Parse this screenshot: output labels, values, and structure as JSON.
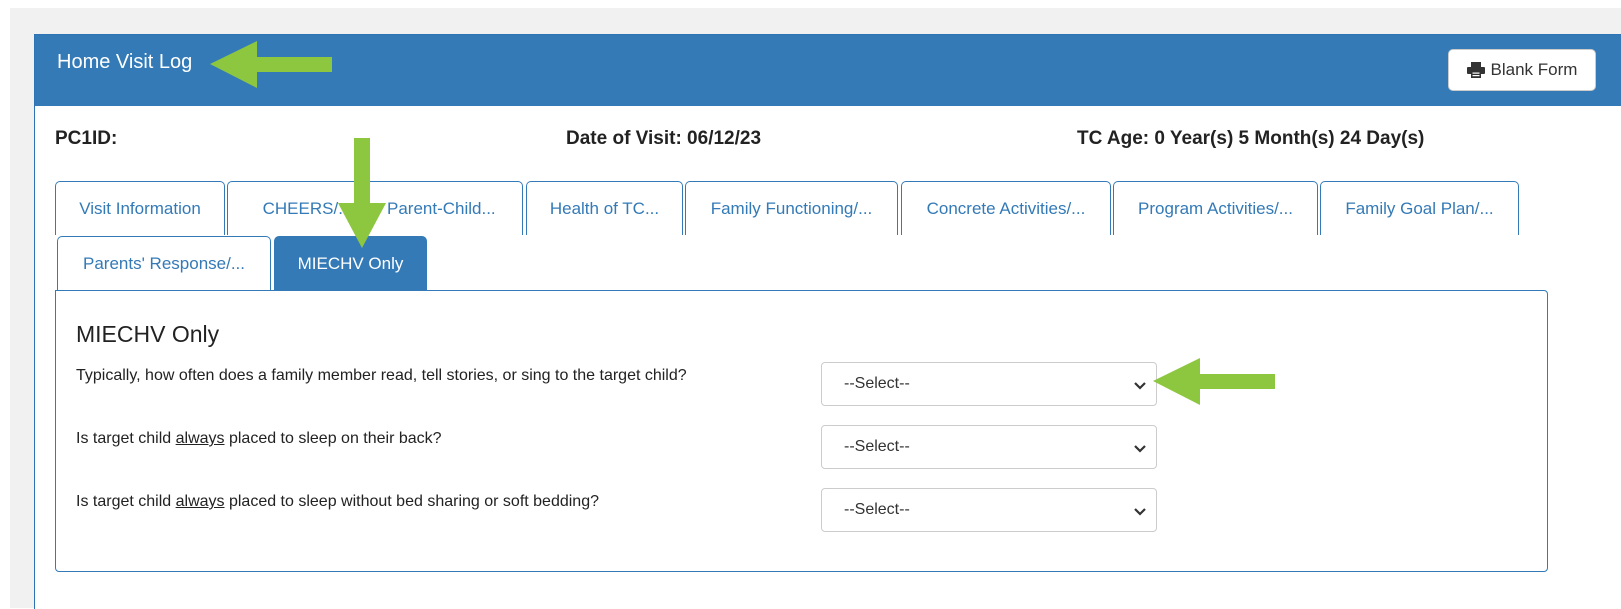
{
  "panel": {
    "title": "Home Visit Log",
    "blank_form_label": "Blank Form"
  },
  "info": {
    "pc1id": "PC1ID:",
    "date_of_visit": "Date of Visit: 06/12/23",
    "tc_age": "TC Age: 0 Year(s) 5 Month(s) 24 Day(s)"
  },
  "tabs": [
    {
      "label": "Visit Information"
    },
    {
      "label": "CHEERS/..."
    },
    {
      "label": "Parent-Child..."
    },
    {
      "label": "Health of TC..."
    },
    {
      "label": "Family Functioning/..."
    },
    {
      "label": "Concrete Activities/..."
    },
    {
      "label": "Program Activities/..."
    },
    {
      "label": "Family Goal Plan/..."
    },
    {
      "label": "Parents' Response/..."
    },
    {
      "label": "MIECHV Only",
      "active": true
    }
  ],
  "section": {
    "title": "MIECHV Only",
    "questions": [
      {
        "pre": "Typically, how often does a family member read, tell stories, or sing to the target child?",
        "emph": "",
        "post": "",
        "select_value": "--Select--"
      },
      {
        "pre": "Is target child ",
        "emph": "always",
        "post": " placed to sleep on their back?",
        "select_value": "--Select--"
      },
      {
        "pre": "Is target child ",
        "emph": "always",
        "post": " placed to sleep without bed sharing or soft bedding?",
        "select_value": "--Select--"
      }
    ]
  },
  "colors": {
    "primary": "#337ab7",
    "annotation_arrow": "#8dc63f",
    "page_bg": "#f1f1f1"
  },
  "icons": {
    "print": "printer-icon",
    "chevron": "chevron-down-icon",
    "arrow": "annotation-arrow-icon"
  }
}
